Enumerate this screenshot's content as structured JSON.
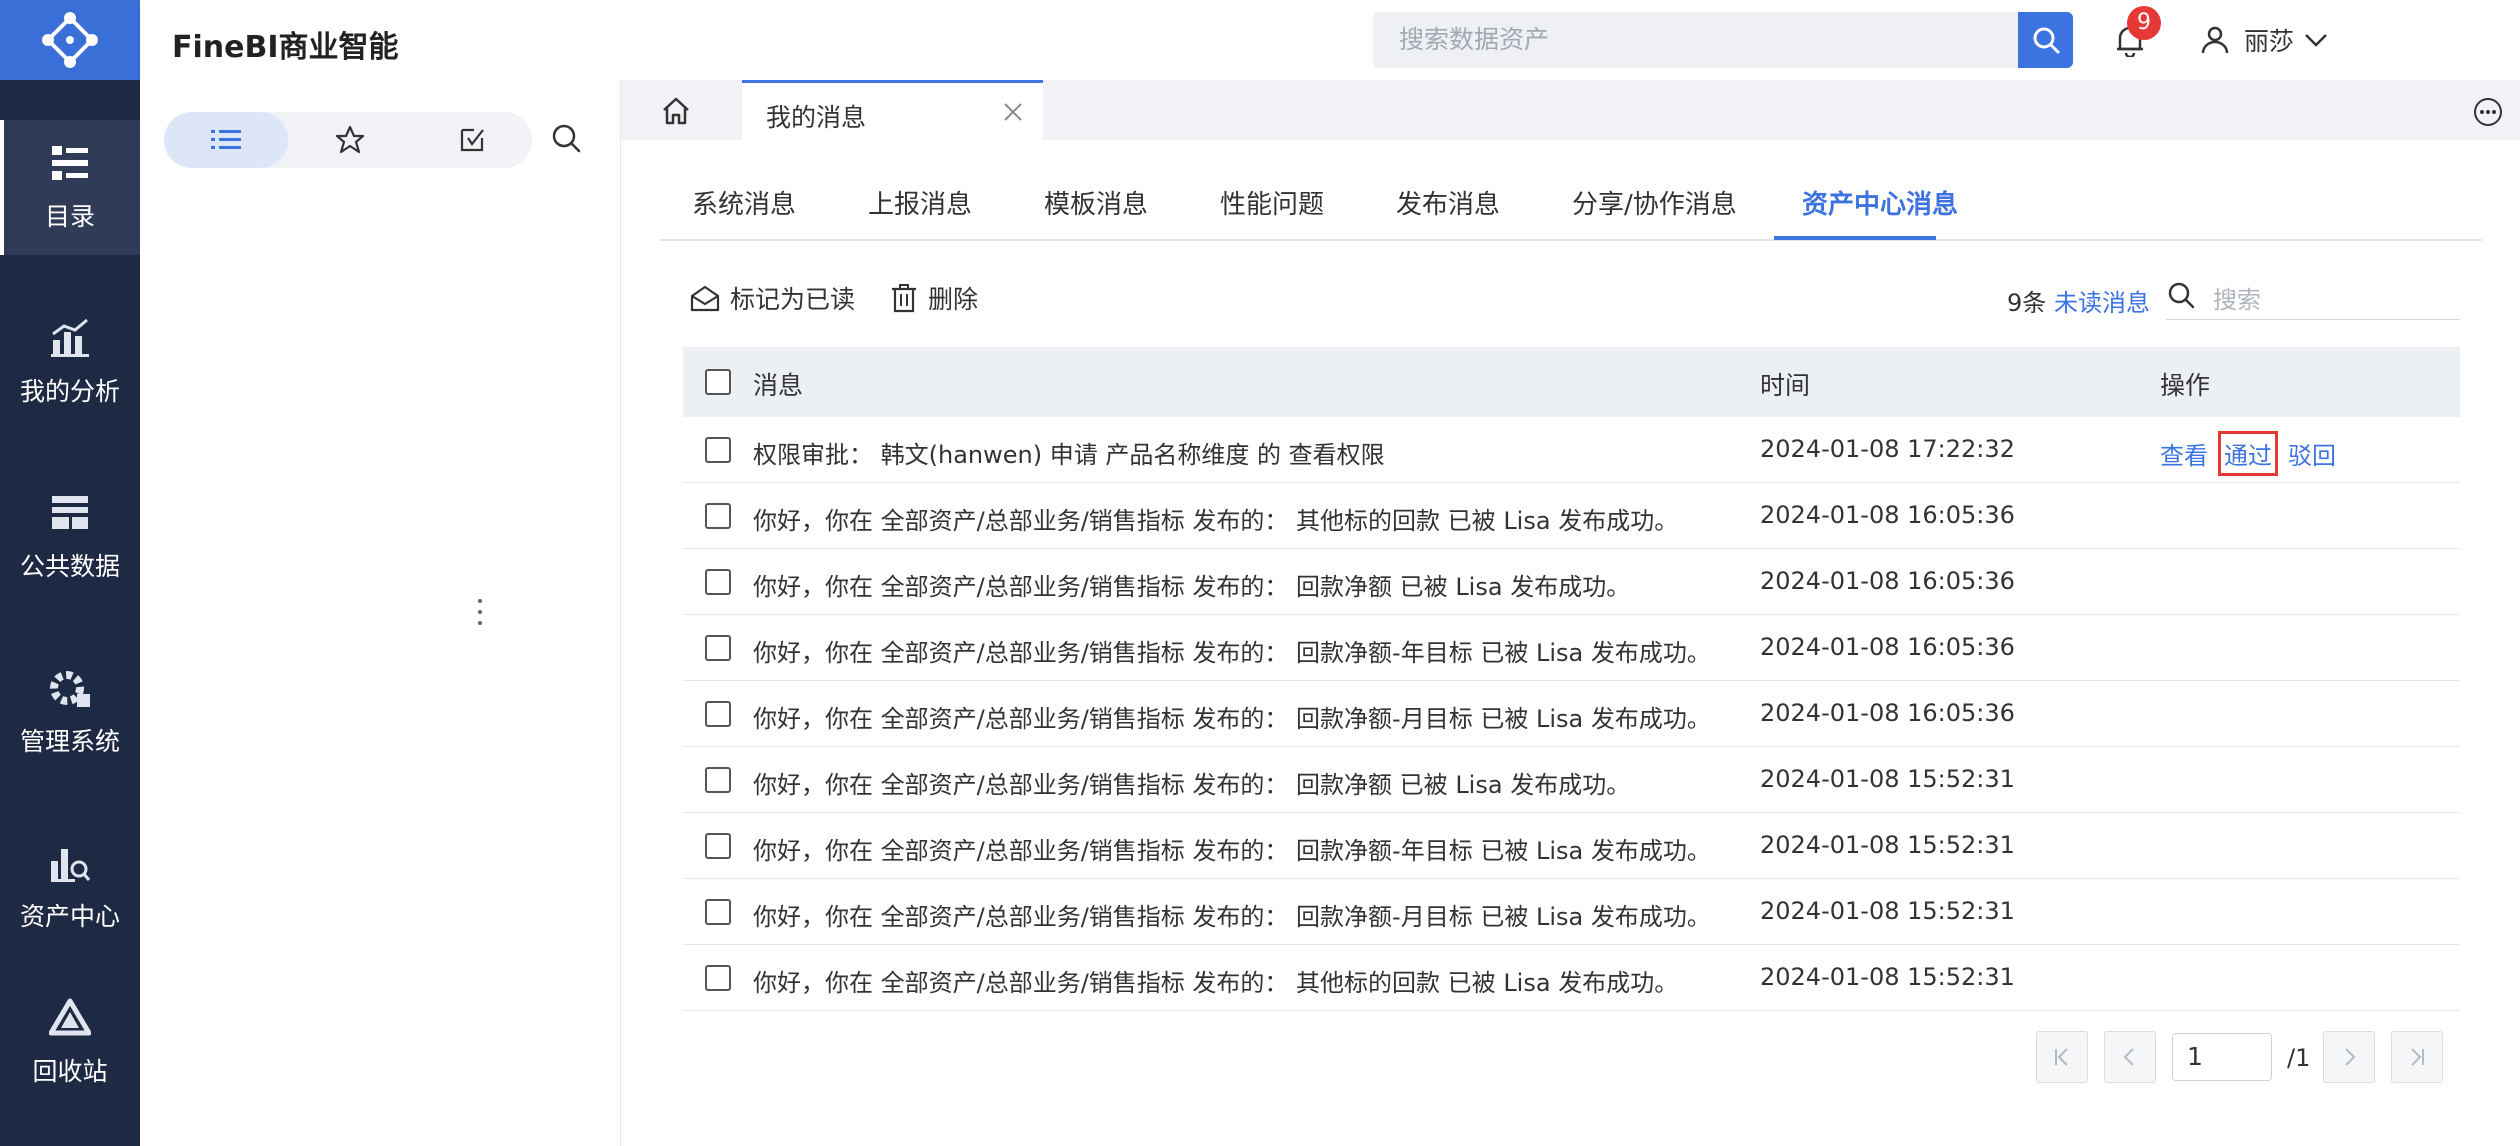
{
  "app": {
    "title": "FineBI商业智能"
  },
  "nav": {
    "items": [
      {
        "label": "目录",
        "icon": "catalog-icon",
        "active": true
      },
      {
        "label": "我的分析",
        "icon": "analysis-icon"
      },
      {
        "label": "公共数据",
        "icon": "public-data-icon"
      },
      {
        "label": "管理系统",
        "icon": "gear-icon"
      },
      {
        "label": "资产中心",
        "icon": "asset-center-icon"
      },
      {
        "label": "回收站",
        "icon": "recycle-bin-icon"
      }
    ]
  },
  "header": {
    "search_placeholder": "搜索数据资产",
    "notification_count": "9",
    "user_name": "丽莎"
  },
  "tabs": {
    "active_tab": "我的消息"
  },
  "message_tabs": [
    "系统消息",
    "上报消息",
    "模板消息",
    "性能问题",
    "发布消息",
    "分享/协作消息",
    "资产中心消息"
  ],
  "active_message_tab": "资产中心消息",
  "toolbar": {
    "mark_read": "标记为已读",
    "delete": "删除",
    "count": "9条",
    "unread": "未读消息",
    "search_placeholder": "搜索"
  },
  "table": {
    "headers": {
      "message": "消息",
      "time": "时间",
      "actions": "操作"
    },
    "rows": [
      {
        "message": "权限审批：  韩文(hanwen) 申请 产品名称维度 的 查看权限",
        "time": "2024-01-08 17:22:32"
      },
      {
        "message": "你好，你在 全部资产/总部业务/销售指标 发布的：  其他标的回款 已被 Lisa 发布成功。",
        "time": "2024-01-08 16:05:36"
      },
      {
        "message": "你好，你在 全部资产/总部业务/销售指标 发布的：  回款净额 已被 Lisa 发布成功。",
        "time": "2024-01-08 16:05:36"
      },
      {
        "message": "你好，你在 全部资产/总部业务/销售指标 发布的：  回款净额-年目标 已被 Lisa 发布成功。",
        "time": "2024-01-08 16:05:36"
      },
      {
        "message": "你好，你在 全部资产/总部业务/销售指标 发布的：  回款净额-月目标 已被 Lisa 发布成功。",
        "time": "2024-01-08 16:05:36"
      },
      {
        "message": "你好，你在 全部资产/总部业务/销售指标 发布的：  回款净额 已被 Lisa 发布成功。",
        "time": "2024-01-08 15:52:31"
      },
      {
        "message": "你好，你在 全部资产/总部业务/销售指标 发布的：  回款净额-年目标 已被 Lisa 发布成功。",
        "time": "2024-01-08 15:52:31"
      },
      {
        "message": "你好，你在 全部资产/总部业务/销售指标 发布的：  回款净额-月目标 已被 Lisa 发布成功。",
        "time": "2024-01-08 15:52:31"
      },
      {
        "message": "你好，你在 全部资产/总部业务/销售指标 发布的：  其他标的回款 已被 Lisa 发布成功。",
        "time": "2024-01-08 15:52:31"
      }
    ],
    "row_actions": {
      "view": "查看",
      "approve": "通过",
      "reject": "驳回"
    }
  },
  "pagination": {
    "current_page": "1",
    "total_pages": "/1"
  },
  "colors": {
    "accent": "#3c73e0",
    "nav_bg": "#1e2a44",
    "highlight_box": "#e53935",
    "badge": "#e53935"
  }
}
